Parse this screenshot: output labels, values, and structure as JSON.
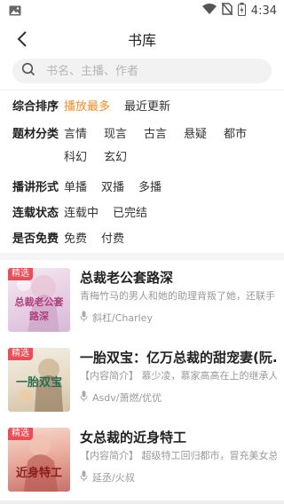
{
  "status_bar": {
    "time": "4:34",
    "icons": [
      "gallery-icon",
      "wifi-icon",
      "no-sim-icon",
      "battery-icon"
    ]
  },
  "header": {
    "title": "书库",
    "back_icon": "back-arrow-icon"
  },
  "search": {
    "placeholder": "书名、主播、作者",
    "icon": "search-icon"
  },
  "filters": {
    "sort": {
      "label": "综合排序",
      "options": [
        "播放最多",
        "最近更新"
      ],
      "selected": "播放最多"
    },
    "genre": {
      "label": "题材分类",
      "options": [
        "言情",
        "现言",
        "古言",
        "悬疑",
        "都市",
        "科幻",
        "玄幻"
      ]
    },
    "format": {
      "label": "播讲形式",
      "options": [
        "单播",
        "双播",
        "多播"
      ]
    },
    "status": {
      "label": "连载状态",
      "options": [
        "连载中",
        "已完结"
      ]
    },
    "price": {
      "label": "是否免费",
      "options": [
        "免费",
        "付费"
      ]
    }
  },
  "books": [
    {
      "badge": "精选",
      "cover_text": "总裁老公套路深",
      "title": "总裁老公套路深",
      "desc": "青梅竹马的男人和她的助理背叛了她，还联手",
      "author": "斜杠/Charley"
    },
    {
      "badge": "精选",
      "cover_text": "一胎双宝",
      "title": "一胎双宝：亿万总裁的甜宠妻(阮...",
      "desc": "【内容简介】 慕少凌，慕家高高在上的继承人",
      "author": "Asdv/萧燃/优优"
    },
    {
      "badge": "精选",
      "cover_text": "近身特工",
      "title": "女总裁的近身特工",
      "desc": "【内容简介】 超级特工回归都市，冒充美女总",
      "author": "延丞/火叔"
    }
  ],
  "colors": {
    "accent": "#ff8a1e",
    "badge": "#f04b55",
    "muted": "#999999"
  }
}
